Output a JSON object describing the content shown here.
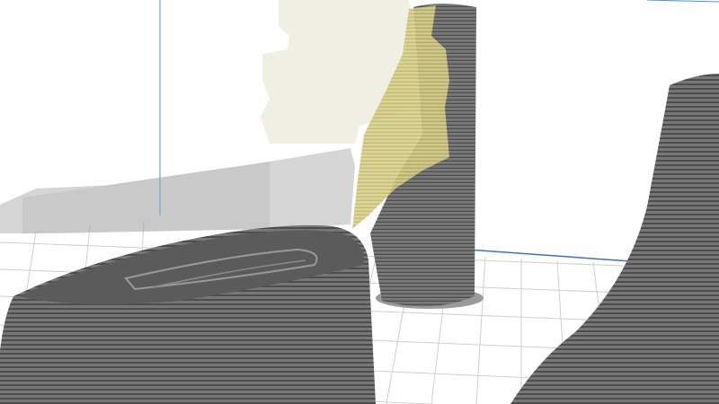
{
  "viewport": {
    "view": "3d-layer-preview",
    "colors": {
      "background": "#ffffff",
      "grid_line": "#c8c8c8",
      "build_plate_edge": "#3c6fd6",
      "axis_line": "#4f8ee8",
      "printed_layer": "#6e6e6e",
      "layer_stripe": "#4a4a4a",
      "ghost_model": "#9a9a9a",
      "unprinted_highlight": "#d8d08a"
    },
    "objects": [
      {
        "name": "printed-curved-block",
        "state": "sliced"
      },
      {
        "name": "printed-column",
        "state": "sliced"
      },
      {
        "name": "printed-flared-tower",
        "state": "sliced"
      },
      {
        "name": "ghost-model-left",
        "state": "unsliced-preview"
      },
      {
        "name": "ghost-model-upper",
        "state": "unsliced-preview"
      }
    ]
  }
}
